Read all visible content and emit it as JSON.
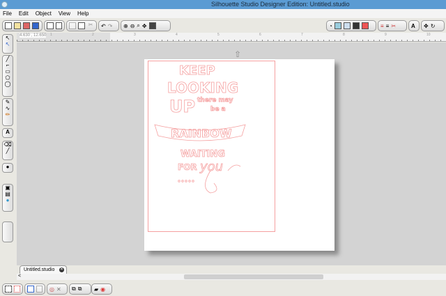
{
  "window": {
    "title": "Silhouette Studio Designer Edition: Untitled.studio"
  },
  "menu": [
    "File",
    "Edit",
    "Object",
    "View",
    "Help"
  ],
  "ruler": {
    "coordinates": "4.630 , 12.650",
    "labels": [
      "1",
      "2",
      "3",
      "4",
      "5",
      "6",
      "7",
      "8",
      "9",
      "10"
    ]
  },
  "document_tab": {
    "label": "Untitled.studio"
  },
  "artwork": {
    "lines": [
      "KEEP",
      "LOOKING",
      "UP",
      "there may",
      "be a",
      "RAINBOW",
      "WAITING",
      "FOR",
      "you"
    ],
    "stroke_color": "#f5a0a0"
  },
  "scroll_left": "<"
}
